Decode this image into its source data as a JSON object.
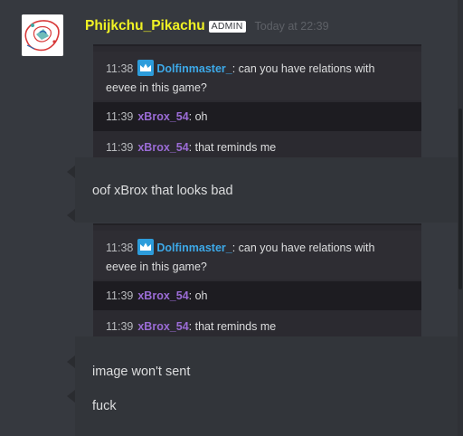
{
  "message": {
    "username": "Phijkchu_Pikachu",
    "badge": "ADMIN",
    "timestamp": "Today at 22:39",
    "username_color": "#f0f224"
  },
  "embeds": [
    {
      "question": {
        "time": "11:38",
        "author": "Dolfinmaster_",
        "text_line1": ": can you have relations with",
        "text_line2": "eevee in this game?"
      },
      "replies": [
        {
          "time": "11:39",
          "author": "xBrox_54",
          "text": ": oh"
        },
        {
          "time": "11:39",
          "author": "xBrox_54",
          "text": ": that reminds me"
        }
      ]
    },
    {
      "question": {
        "time": "11:38",
        "author": "Dolfinmaster_",
        "text_line1": ": can you have relations with",
        "text_line2": "eevee in this game?"
      },
      "replies": [
        {
          "time": "11:39",
          "author": "xBrox_54",
          "text": ": oh"
        },
        {
          "time": "11:39",
          "author": "xBrox_54",
          "text": ": that reminds me"
        }
      ]
    }
  ],
  "messages": [
    "oof xBrox that looks bad",
    "image won't sent",
    "fuck"
  ],
  "icons": {
    "avatar": "avatar-image",
    "moderator": "crown-icon"
  },
  "colors": {
    "background": "#36393f",
    "author_blue": "#3da9e8",
    "author_purple": "#9b6cd6"
  }
}
